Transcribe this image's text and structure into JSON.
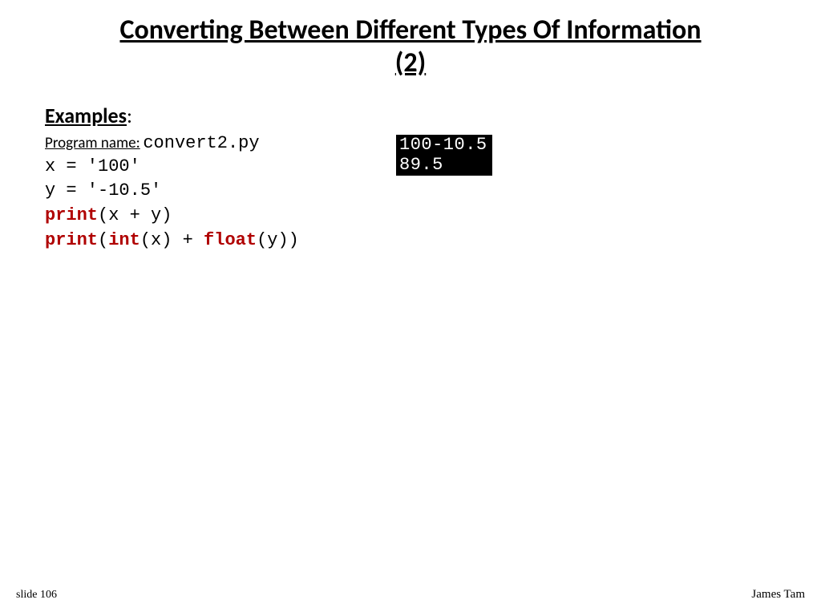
{
  "title_line1": "Converting Between Different Types Of Information",
  "title_line2": "(2)",
  "subheading": "Examples",
  "subheading_colon": ":",
  "program_label": "Program name:",
  "program_name": "convert2.py",
  "code": {
    "l1": "x = '100'",
    "l2": "y = '-10.5'",
    "l3a": "print",
    "l3b": "(x + y)",
    "l4a": "print",
    "l4b": "(",
    "l4c": "int",
    "l4d": "(x) + ",
    "l4e": "float",
    "l4f": "(y))"
  },
  "console": {
    "row1": "100-10.5",
    "row2": "89.5"
  },
  "footer": {
    "slide": "slide 106",
    "author": "James Tam"
  }
}
